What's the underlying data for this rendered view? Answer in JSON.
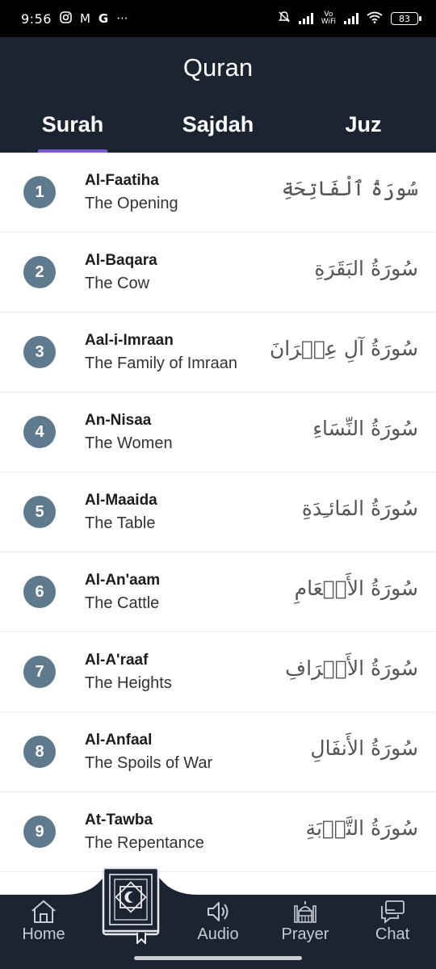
{
  "status_bar": {
    "time": "9:56",
    "notification_icons": [
      "instagram-icon",
      "gmail-icon",
      "google-icon",
      "more-icon"
    ],
    "more": "···",
    "google": "G",
    "gmail": "M",
    "vowifi_top": "Vo",
    "vowifi_bottom": "WiFi",
    "battery": "83"
  },
  "header": {
    "title": "Quran",
    "tabs": [
      {
        "label": "Surah",
        "active": true
      },
      {
        "label": "Sajdah",
        "active": false
      },
      {
        "label": "Juz",
        "active": false
      }
    ]
  },
  "surahs": [
    {
      "number": "1",
      "name": "Al-Faatiha",
      "meaning": "The Opening",
      "arabic": "سُورَةُ ٱلْفَاتِحَةِ"
    },
    {
      "number": "2",
      "name": "Al-Baqara",
      "meaning": "The Cow",
      "arabic": "سُورَةُ البَقَرَةِ"
    },
    {
      "number": "3",
      "name": "Aal-i-Imraan",
      "meaning": "The Family of Imraan",
      "arabic": "سُورَةُ آلِ عِمۡرَانَ"
    },
    {
      "number": "4",
      "name": "An-Nisaa",
      "meaning": "The Women",
      "arabic": "سُورَةُ النِّسَاءِ"
    },
    {
      "number": "5",
      "name": "Al-Maaida",
      "meaning": "The Table",
      "arabic": "سُورَةُ المَائـِدَةِ"
    },
    {
      "number": "6",
      "name": "Al-An'aam",
      "meaning": "The Cattle",
      "arabic": "سُورَةُ الأَنۡعَامِ"
    },
    {
      "number": "7",
      "name": "Al-A'raaf",
      "meaning": "The Heights",
      "arabic": "سُورَةُ الأَعۡرَافِ"
    },
    {
      "number": "8",
      "name": "Al-Anfaal",
      "meaning": "The Spoils of War",
      "arabic": "سُورَةُ الأَنفَالِ"
    },
    {
      "number": "9",
      "name": "At-Tawba",
      "meaning": "The Repentance",
      "arabic": "سُورَةُ التَّوۡبَةِ"
    }
  ],
  "bottom_nav": {
    "home": "Home",
    "audio": "Audio",
    "prayer": "Prayer",
    "chat": "Chat",
    "center_icon": "quran-book-icon"
  },
  "colors": {
    "header_bg": "#1c2331",
    "tab_indicator": "#7b5ad6",
    "number_badge": "#5f7a8c"
  }
}
